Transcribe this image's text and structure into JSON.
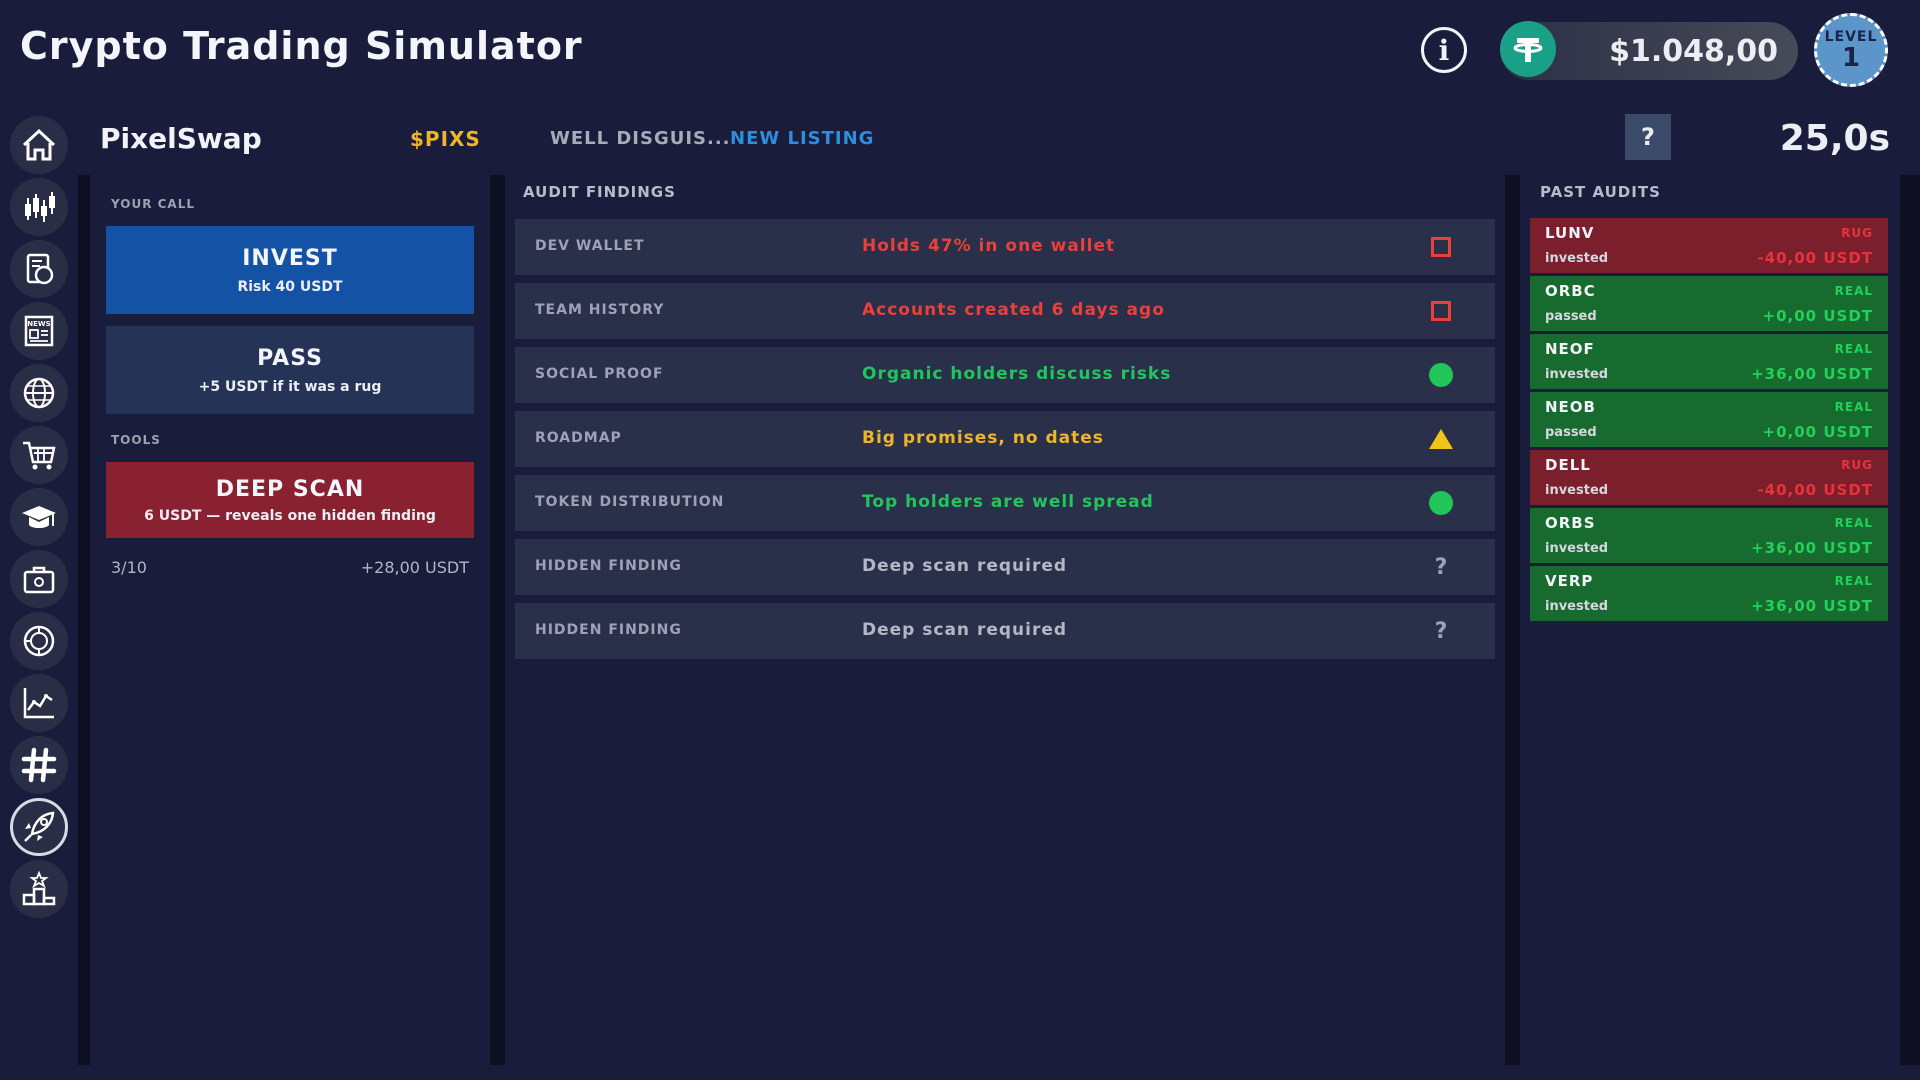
{
  "app": {
    "title": "Crypto Trading Simulator"
  },
  "wallet": {
    "balance": "$1.048,00",
    "currency_icon": "tether-icon"
  },
  "player": {
    "level_label": "LEVEL",
    "level": "1"
  },
  "sidebar": {
    "items": [
      {
        "name": "home",
        "icon": "home-icon"
      },
      {
        "name": "trading",
        "icon": "candlestick-icon"
      },
      {
        "name": "portfolio",
        "icon": "document-coin-icon"
      },
      {
        "name": "news",
        "icon": "news-icon",
        "text": "NEWS"
      },
      {
        "name": "world",
        "icon": "globe-icon"
      },
      {
        "name": "shop",
        "icon": "cart-icon"
      },
      {
        "name": "learn",
        "icon": "graduation-cap-icon"
      },
      {
        "name": "wallet",
        "icon": "briefcase-icon"
      },
      {
        "name": "staking",
        "icon": "coin-chart-icon"
      },
      {
        "name": "analytics",
        "icon": "line-chart-icon"
      },
      {
        "name": "social",
        "icon": "hashtag-icon"
      },
      {
        "name": "launchpad",
        "icon": "rocket-icon",
        "active": true
      },
      {
        "name": "leaderboard",
        "icon": "podium-icon"
      }
    ]
  },
  "token": {
    "name": "PixelSwap",
    "ticker": "$PIXS",
    "tag1": "WELL DISGUIS...",
    "tag2": "NEW LISTING",
    "help": "?",
    "timer": "25,0s"
  },
  "your_call": {
    "label": "YOUR CALL",
    "invest": {
      "title": "INVEST",
      "sub": "Risk 40 USDT"
    },
    "pass": {
      "title": "PASS",
      "sub": "+5 USDT if it was a rug"
    }
  },
  "tools": {
    "label": "TOOLS",
    "deep_scan": {
      "title": "DEEP SCAN",
      "sub": "6 USDT — reveals one hidden finding"
    }
  },
  "progress": {
    "count": "3/10",
    "earnings": "+28,00 USDT"
  },
  "audit": {
    "title": "AUDIT FINDINGS",
    "findings": [
      {
        "label": "DEV WALLET",
        "value": "Holds 47% in one wallet",
        "status": "red-flag",
        "color": "#e8413a"
      },
      {
        "label": "TEAM HISTORY",
        "value": "Accounts created 6 days ago",
        "status": "red-flag",
        "color": "#e8413a"
      },
      {
        "label": "SOCIAL PROOF",
        "value": "Organic holders discuss risks",
        "status": "ok",
        "color": "#21c65a"
      },
      {
        "label": "ROADMAP",
        "value": "Big promises, no dates",
        "status": "warning",
        "color": "#f0b429"
      },
      {
        "label": "TOKEN DISTRIBUTION",
        "value": "Top holders are well spread",
        "status": "ok",
        "color": "#21c65a"
      },
      {
        "label": "HIDDEN FINDING",
        "value": "Deep scan required",
        "status": "hidden",
        "color": "#b4b7c6"
      },
      {
        "label": "HIDDEN FINDING",
        "value": "Deep scan required",
        "status": "hidden",
        "color": "#b4b7c6"
      }
    ],
    "hidden_mark": "?"
  },
  "past_audits": {
    "title": "PAST AUDITS",
    "items": [
      {
        "ticker": "LUNV",
        "status": "RUG",
        "action": "invested",
        "amount": "-40,00 USDT"
      },
      {
        "ticker": "ORBC",
        "status": "REAL",
        "action": "passed",
        "amount": "+0,00 USDT"
      },
      {
        "ticker": "NEOF",
        "status": "REAL",
        "action": "invested",
        "amount": "+36,00 USDT"
      },
      {
        "ticker": "NEOB",
        "status": "REAL",
        "action": "passed",
        "amount": "+0,00 USDT"
      },
      {
        "ticker": "DELL",
        "status": "RUG",
        "action": "invested",
        "amount": "-40,00 USDT"
      },
      {
        "ticker": "ORBS",
        "status": "REAL",
        "action": "invested",
        "amount": "+36,00 USDT"
      },
      {
        "ticker": "VERP",
        "status": "REAL",
        "action": "invested",
        "amount": "+36,00 USDT"
      }
    ]
  }
}
